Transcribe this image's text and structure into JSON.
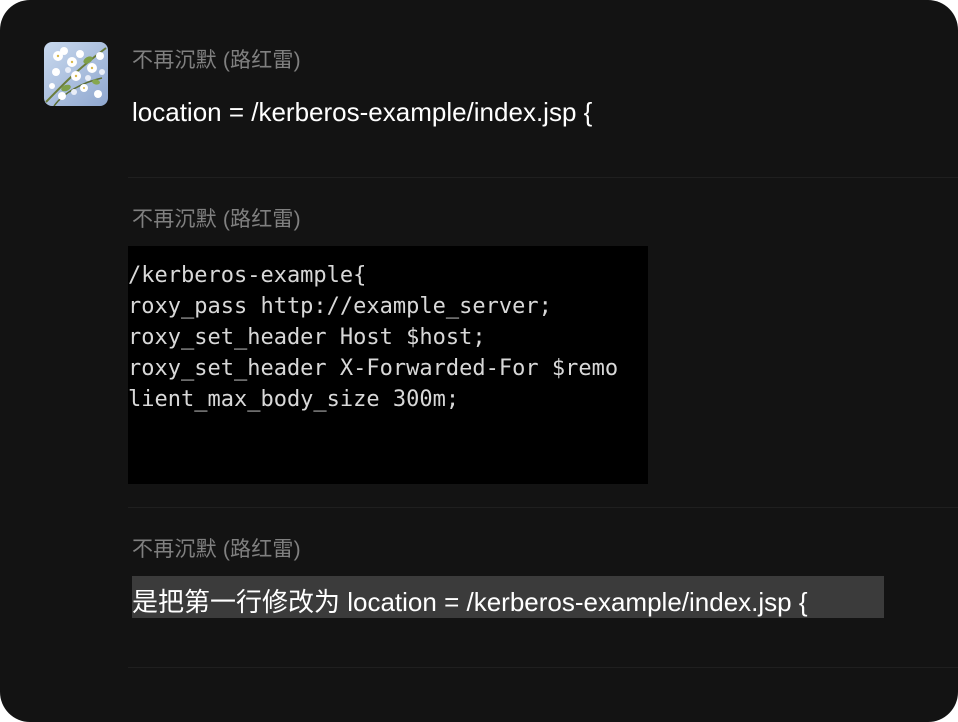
{
  "messages": [
    {
      "sender": "不再沉默 (路红雷)",
      "text": "location = /kerberos-example/index.jsp {"
    },
    {
      "sender": "不再沉默 (路红雷)",
      "code_lines": [
        "/kerberos-example{",
        "roxy_pass http://example_server;",
        "roxy_set_header Host $host;",
        "roxy_set_header X-Forwarded-For $remo",
        "lient_max_body_size 300m;"
      ]
    },
    {
      "sender": "不再沉默 (路红雷)",
      "text": "是把第一行修改为 location = /kerberos-example/index.jsp {"
    }
  ],
  "avatar": {
    "icon": "flower-photo-avatar"
  },
  "colors": {
    "background": "#131313",
    "sender": "#808080",
    "message": "#ffffff",
    "highlight": "#3b3b3b",
    "code_background": "#000000"
  }
}
